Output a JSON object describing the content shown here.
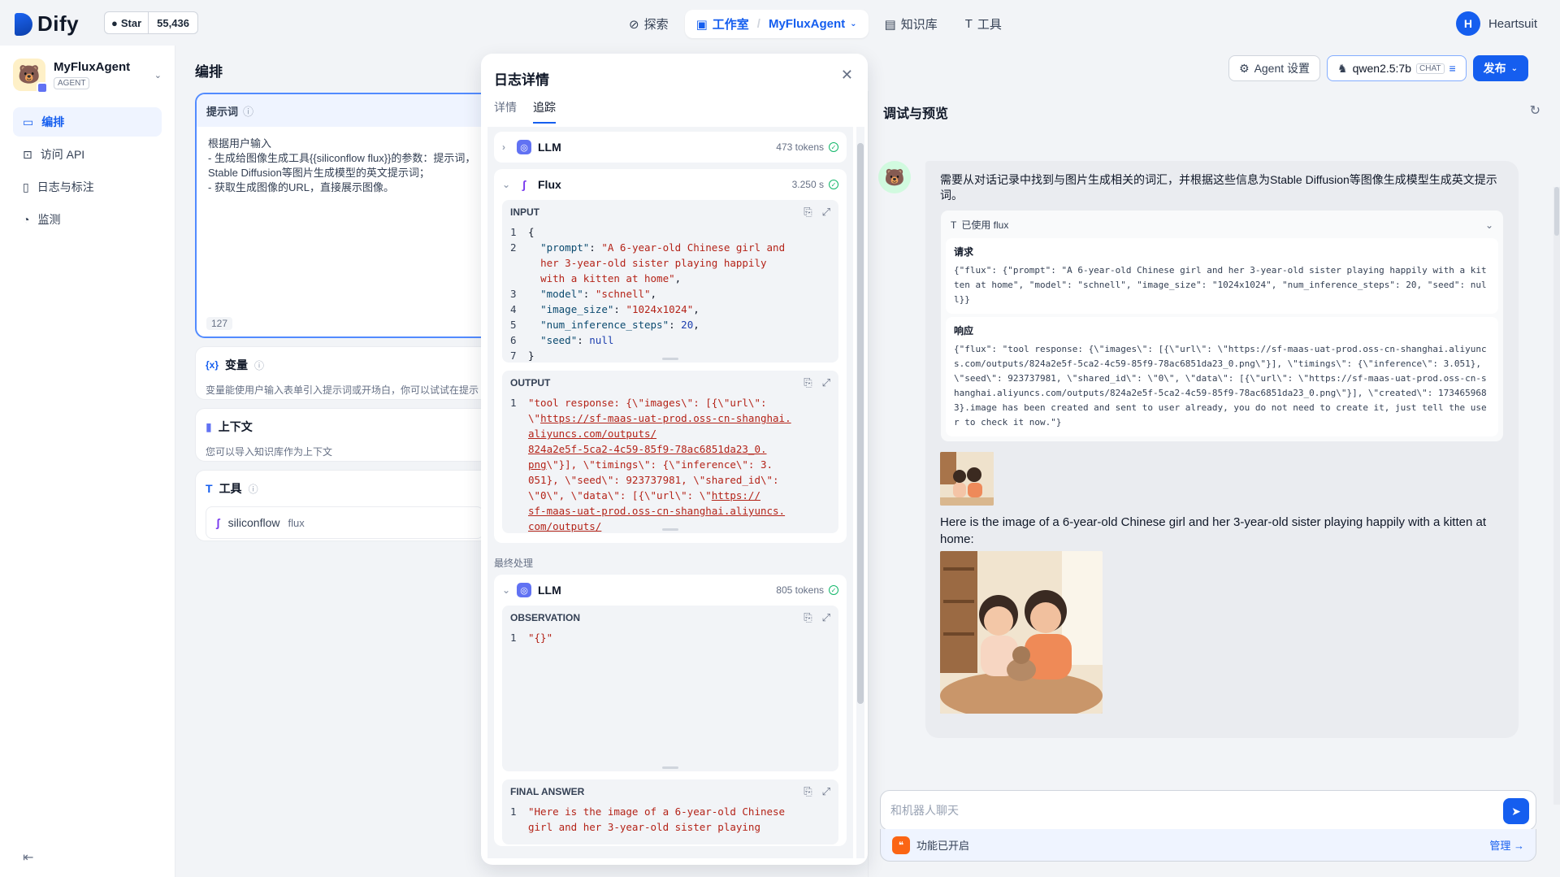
{
  "brand": {
    "name": "Dify",
    "accent": "#155eef"
  },
  "github": {
    "star_label": "Star",
    "count": "55,436"
  },
  "nav": {
    "explore": "探索",
    "studio": "工作室",
    "app_name": "MyFluxAgent",
    "knowledge": "知识库",
    "tools": "工具"
  },
  "user": {
    "initial": "H",
    "name": "Heartsuit"
  },
  "sidebar": {
    "app_name": "MyFluxAgent",
    "app_type": "AGENT",
    "items": [
      {
        "label": "编排",
        "icon": "layout-icon"
      },
      {
        "label": "访问 API",
        "icon": "terminal-icon"
      },
      {
        "label": "日志与标注",
        "icon": "file-icon"
      },
      {
        "label": "监测",
        "icon": "gauge-icon"
      }
    ]
  },
  "orchestrate": {
    "title": "编排",
    "prompt_label": "提示词",
    "prompt_lines": [
      "根据用户输入",
      "- 生成给图像生成工具{{siliconflow flux}}的参数：提示词，",
      "Stable Diffusion等图片生成模型的英文提示词；",
      "- 获取生成图像的URL，直接展示图像。"
    ],
    "prompt_count": "127",
    "variables_label": "变量",
    "variables_desc": "变量能使用户输入表单引入提示词或开场白，你可以试试在提示",
    "context_label": "上下文",
    "context_desc": "您可以导入知识库作为上下文",
    "tools_label": "工具",
    "tool_name": "siliconflow",
    "tool_sub": "flux"
  },
  "toolbar": {
    "agent_settings": "Agent 设置",
    "model": "qwen2.5:7b",
    "model_tag": "CHAT",
    "publish": "发布"
  },
  "log": {
    "title": "日志详情",
    "tabs": [
      "详情",
      "追踪"
    ],
    "llm1": {
      "name": "LLM",
      "meta": "473 tokens"
    },
    "flux": {
      "name": "Flux",
      "meta": "3.250 s"
    },
    "input_label": "INPUT",
    "output_label": "OUTPUT",
    "final_section": "最终处理",
    "llm2": {
      "name": "LLM",
      "meta": "805 tokens"
    },
    "observation_label": "OBSERVATION",
    "observation_value": "\"{}\"",
    "final_answer_label": "FINAL ANSWER",
    "final_answer_lines": [
      "\"Here is the image of a 6-year-old Chinese",
      "girl and her 3-year-old sister playing"
    ]
  },
  "preview": {
    "title": "调试与预览",
    "bot_intro": "需要从对话记录中找到与图片生成相关的词汇，并根据这些信息为Stable Diffusion等图像生成模型生成英文提示词。",
    "tool_used": "已使用 flux",
    "request_label": "请求",
    "request_code": "{\"flux\": {\"prompt\": \"A 6-year-old Chinese girl and her 3-year-old sister playing happily with a kitten at home\", \"model\": \"schnell\", \"image_size\": \"1024x1024\", \"num_inference_steps\": 20, \"seed\": null}}",
    "response_label": "响应",
    "response_code": "{\"flux\": \"tool response: {\\\"images\\\": [{\\\"url\\\": \\\"https://sf-maas-uat-prod.oss-cn-shanghai.aliyuncs.com/outputs/824a2e5f-5ca2-4c59-85f9-78ac6851da23_0.png\\\"}], \\\"timings\\\": {\\\"inference\\\": 3.051}, \\\"seed\\\": 923737981, \\\"shared_id\\\": \\\"0\\\", \\\"data\\\": [{\\\"url\\\": \\\"https://sf-maas-uat-prod.oss-cn-shanghai.aliyuncs.com/outputs/824a2e5f-5ca2-4c59-85f9-78ac6851da23_0.png\\\"}], \\\"created\\\": 1734659683}.image has been created and sent to user already, you do not need to create it, just tell the user to check it now.\"}",
    "answer": "Here is the image of a 6-year-old Chinese girl and her 3-year-old sister playing happily with a kitten at home:",
    "input_placeholder": "和机器人聊天",
    "features_on": "功能已开启",
    "manage": "管理"
  }
}
